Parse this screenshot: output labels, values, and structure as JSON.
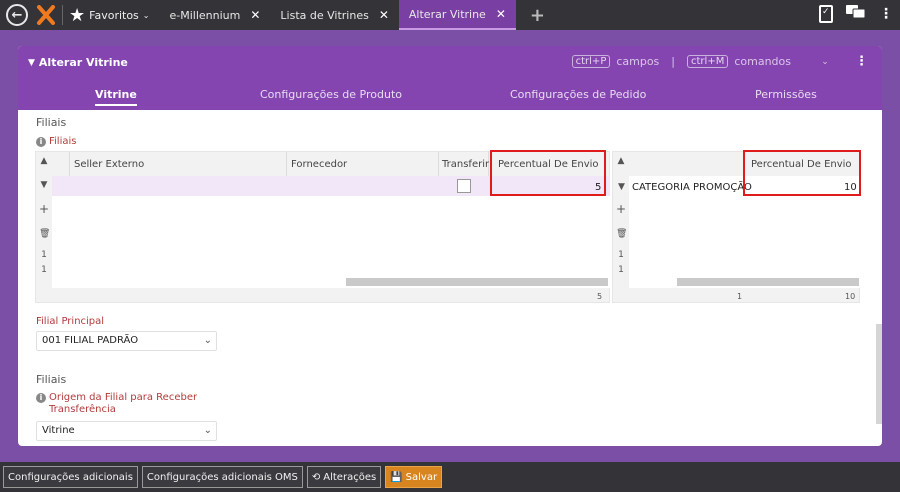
{
  "topbar": {
    "favorites_label": "Favoritos",
    "tabs": [
      {
        "label": "e-Millennium",
        "active": false
      },
      {
        "label": "Lista de Vitrines",
        "active": false
      },
      {
        "label": "Alterar Vitrine",
        "active": true
      }
    ]
  },
  "panel": {
    "title": "Alterar Vitrine",
    "shortcut_fields_key": "ctrl+P",
    "shortcut_fields_label": "campos",
    "shortcut_sep": "|",
    "shortcut_commands_key": "ctrl+M",
    "shortcut_commands_label": "comandos",
    "tabs": [
      "Vitrine",
      "Configurações de Produto",
      "Configurações de Pedido",
      "Permissões"
    ]
  },
  "filiais_section": {
    "title": "Filiais",
    "required_label": "Filiais"
  },
  "grid_left": {
    "columns": [
      "Seller Externo",
      "Fornecedor",
      "Transferir",
      "Percentual De Envio"
    ],
    "rows": [
      {
        "seller": "",
        "fornecedor": "",
        "transferir": false,
        "percentual": "5"
      }
    ],
    "page_marks": [
      "1",
      "1"
    ],
    "footer_total": "5"
  },
  "grid_right": {
    "columns": [
      "",
      "Percentual De Envio"
    ],
    "rows": [
      {
        "nome": "CATEGORIA PROMOÇÃO",
        "percentual": "10"
      }
    ],
    "page_marks": [
      "1",
      "1"
    ],
    "footer_count": "1",
    "footer_total": "10"
  },
  "filial_principal": {
    "label": "Filial Principal",
    "value": "001 FILIAL PADRÃO"
  },
  "filiais_section2": {
    "title": "Filiais",
    "origem_label": "Origem da Filial para Receber Transferência",
    "origem_value": "Vitrine"
  },
  "bottombar": {
    "btn_config": "Configurações adicionais",
    "btn_config_oms": "Configurações adicionais OMS",
    "btn_alteracoes": "Alterações",
    "btn_salvar": "Salvar"
  },
  "colors": {
    "accent": "#8545b0",
    "active_tab": "#7a3fa3",
    "highlight": "#e01b1b",
    "save": "#d9851f"
  }
}
